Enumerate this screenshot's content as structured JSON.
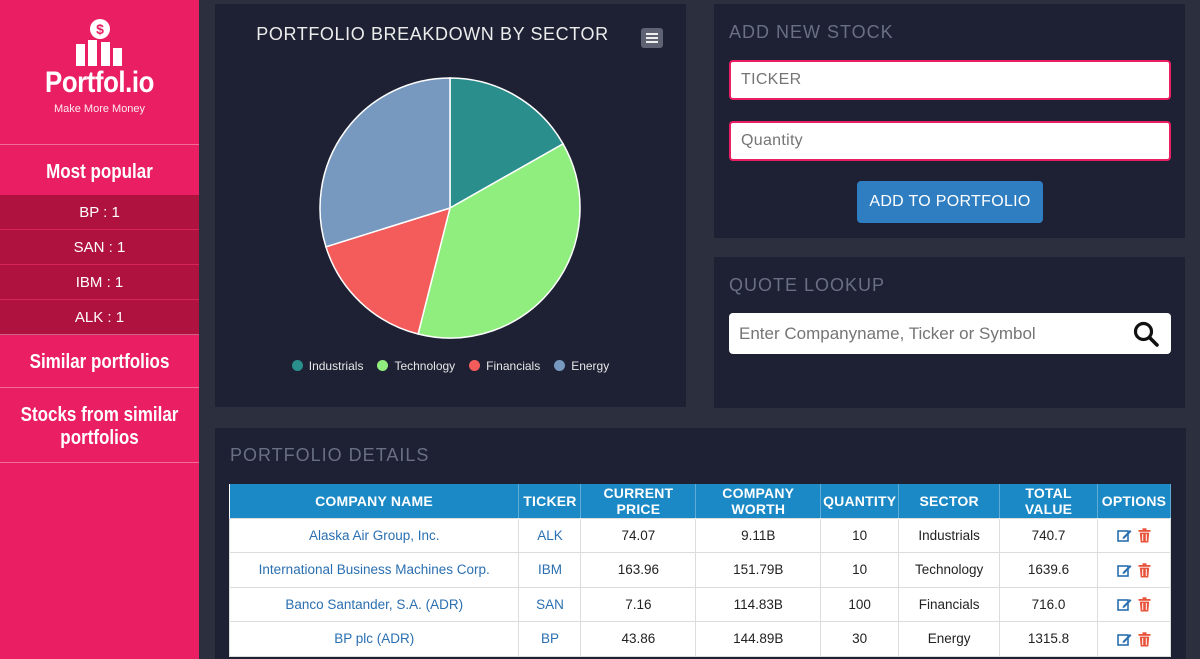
{
  "brand": {
    "title": "Portfol.io",
    "tagline": "Make More Money"
  },
  "sidebar": {
    "most_popular": "Most popular",
    "popular_items": [
      "BP : 1",
      "SAN : 1",
      "IBM : 1",
      "ALK : 1"
    ],
    "similar_portfolios": "Similar portfolios",
    "stocks_from_similar": "Stocks from similar portfolios"
  },
  "pie_panel": {
    "title": "PORTFOLIO BREAKDOWN BY SECTOR",
    "menu_icon": "hamburger-icon"
  },
  "chart_data": {
    "type": "pie",
    "title": "PORTFOLIO BREAKDOWN BY SECTOR",
    "slices": [
      {
        "name": "Industrials",
        "value": 740.7,
        "color": "#2a8e8c"
      },
      {
        "name": "Technology",
        "value": 1639.6,
        "color": "#90ee7e"
      },
      {
        "name": "Financials",
        "value": 716.0,
        "color": "#f45b5b"
      },
      {
        "name": "Energy",
        "value": 1315.8,
        "color": "#7798bf"
      }
    ],
    "legend_position": "bottom"
  },
  "add_stock": {
    "title": "ADD NEW STOCK",
    "ticker_placeholder": "TICKER",
    "quantity_placeholder": "Quantity",
    "button_label": "ADD TO PORTFOLIO"
  },
  "quote_lookup": {
    "title": "QUOTE LOOKUP",
    "placeholder": "Enter Companyname, Ticker or Symbol"
  },
  "details": {
    "title": "PORTFOLIO DETAILS",
    "headers": [
      "COMPANY NAME",
      "TICKER",
      "CURRENT PRICE",
      "COMPANY WORTH",
      "QUANTITY",
      "SECTOR",
      "TOTAL VALUE",
      "OPTIONS"
    ],
    "rows": [
      [
        "Alaska Air Group, Inc.",
        "ALK",
        "74.07",
        "9.11B",
        "10",
        "Industrials",
        "740.7"
      ],
      [
        "International Business Machines Corp.",
        "IBM",
        "163.96",
        "151.79B",
        "10",
        "Technology",
        "1639.6"
      ],
      [
        "Banco Santander, S.A. (ADR)",
        "SAN",
        "7.16",
        "114.83B",
        "100",
        "Financials",
        "716.0"
      ],
      [
        "BP plc (ADR)",
        "BP",
        "43.86",
        "144.89B",
        "30",
        "Energy",
        "1315.8"
      ]
    ]
  },
  "colors": {
    "sidebar": "#e91e63",
    "panel": "#1d2133",
    "table_header": "#1a89c5",
    "button": "#2f7ec1",
    "edit_icon": "#2a6fb0",
    "delete_icon": "#e8533b"
  }
}
